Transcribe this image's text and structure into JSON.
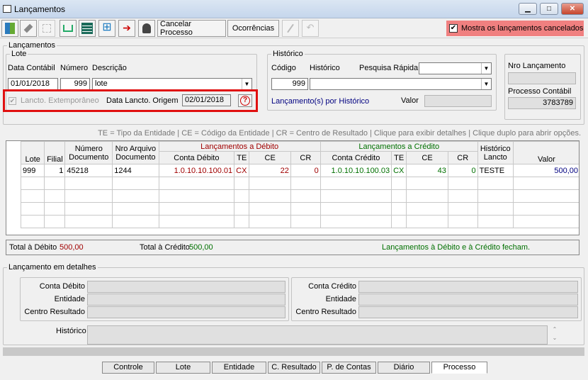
{
  "window": {
    "title": "Lançamentos",
    "min": "▁",
    "max": "□",
    "close": "✕"
  },
  "toolbar": {
    "cancel_process": "Cancelar Processo",
    "occurrences": "Ocorrências",
    "show_cancelled": "Mostra os lançamentos cancelados",
    "show_cancelled_checked": true
  },
  "lancamentos": {
    "group": "Lançamentos",
    "lote": {
      "group": "Lote",
      "data_label": "Data Contábil",
      "numero_label": "Número",
      "descricao_label": "Descrição",
      "data": "01/01/2018",
      "numero": "999",
      "descricao": "lote",
      "extemporaneo_label": "Lancto. Extemporâneo",
      "origem_label": "Data Lancto. Origem",
      "origem": "02/01/2018"
    },
    "historico": {
      "group": "Histórico",
      "codigo_label": "Código",
      "historico_label": "Histórico",
      "pesquisa_label": "Pesquisa Rápida",
      "codigo": "999",
      "link": "Lançamento(s) por Histórico",
      "valor_label": "Valor"
    },
    "nro_lancamento_label": "Nro Lançamento",
    "processo_label": "Processo Contábil",
    "processo": "3783789"
  },
  "legend": "TE = Tipo da Entidade | CE = Código da Entidade | CR = Centro de Resultado | Clique para exibir detalhes | Clique duplo para abrir opções.",
  "grid": {
    "debit_header": "Lançamentos a Débito",
    "credit_header": "Lançamentos a Crédito",
    "columns": {
      "lote": "Lote",
      "filial": "Filial",
      "numero_doc": [
        "Número",
        "Documento"
      ],
      "nro_arquivo": [
        "Nro Arquivo",
        "Documento"
      ],
      "conta_debito": "Conta Débito",
      "te": "TE",
      "ce": "CE",
      "cr": "CR",
      "conta_credito": "Conta Crédito",
      "historico": [
        "Histórico",
        "Lancto"
      ],
      "valor": "Valor"
    },
    "rows": [
      {
        "lote": "999",
        "filial": "1",
        "numero": "45218",
        "arquivo": "1244",
        "conta_debito": "1.0.10.10.100.01",
        "te_d": "CX",
        "ce_d": "22",
        "cr_d": "0",
        "conta_credito": "1.0.10.10.100.03",
        "te_c": "CX",
        "ce_c": "43",
        "cr_c": "0",
        "historico": "TESTE",
        "valor": "500,00"
      }
    ]
  },
  "totals": {
    "debito_label": "Total à Débito",
    "debito": "500,00",
    "credito_label": "Total à Crédito",
    "credito": "500,00",
    "status": "Lançamentos à Débito e à Crédito fecham."
  },
  "details": {
    "group": "Lançamento em detalhes",
    "conta_debito": "Conta Débito",
    "entidade": "Entidade",
    "centro": "Centro Resultado",
    "conta_credito": "Conta Crédito",
    "historico": "Histórico"
  },
  "tabs": [
    "Controle",
    "Lote",
    "Entidade",
    "C. Resultado",
    "P. de Contas",
    "Diário",
    "Processo"
  ],
  "active_tab": "Processo",
  "colors": {
    "highlight_red": "#e01010",
    "debit": "#a00000",
    "credit": "#007000",
    "value": "#000080"
  }
}
